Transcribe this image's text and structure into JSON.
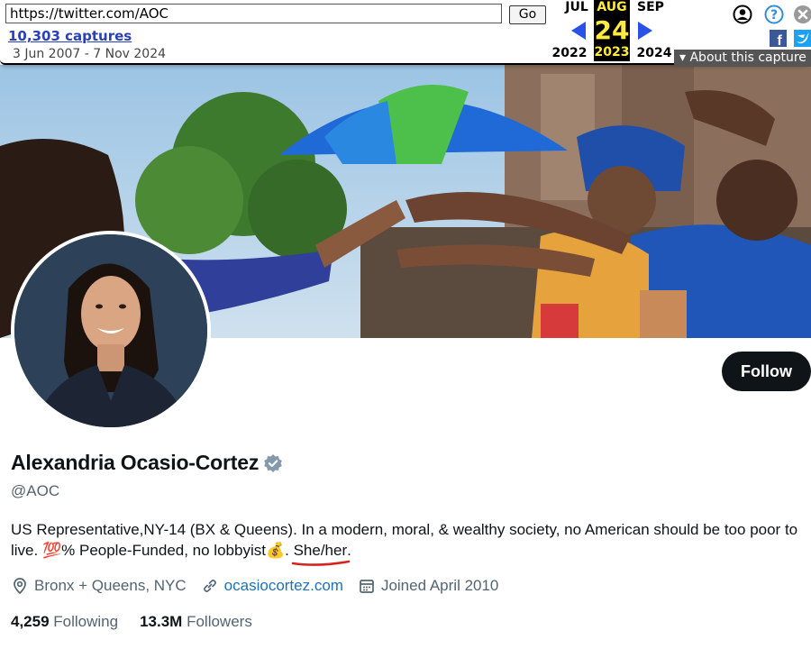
{
  "wayback": {
    "url": "https://twitter.com/AOC",
    "go_label": "Go",
    "captures_label": "10,303 captures",
    "date_range": "3 Jun 2007 - 7 Nov 2024",
    "prev_month": "JUL",
    "current_month": "AUG",
    "next_month": "SEP",
    "day": "24",
    "prev_year": "2022",
    "current_year": "2023",
    "next_year": "2024",
    "about_label": "About this capture",
    "colors": {
      "link": "#2a40b8",
      "highlight": "#ffeb3b",
      "arrow": "#2a52e8"
    },
    "icons": [
      "user-circle-icon",
      "help-icon",
      "close-icon",
      "facebook-icon",
      "twitter-icon"
    ]
  },
  "profile": {
    "follow_label": "Follow",
    "name": "Alexandria Ocasio-Cortez",
    "handle": "@AOC",
    "bio_part1": "US Representative,NY-14 (BX & Queens). In a modern, moral, & wealthy society, no American should be too poor to live. ",
    "bio_emoji_hundred": "💯",
    "bio_part2": "% People-Funded, no lobbyist",
    "bio_emoji_money": "💰",
    "bio_part3": ". ",
    "pronouns": "She/her",
    "bio_end": ".",
    "location": "Bronx + Queens, NYC",
    "website": "ocasiocortez.com",
    "joined": "Joined April 2010",
    "following_count": "4,259",
    "following_label": "Following",
    "followers_count": "13.3M",
    "followers_label": "Followers",
    "colors": {
      "link": "#1d72b8",
      "verified": "#829aab",
      "secondary_text": "#536471"
    }
  }
}
